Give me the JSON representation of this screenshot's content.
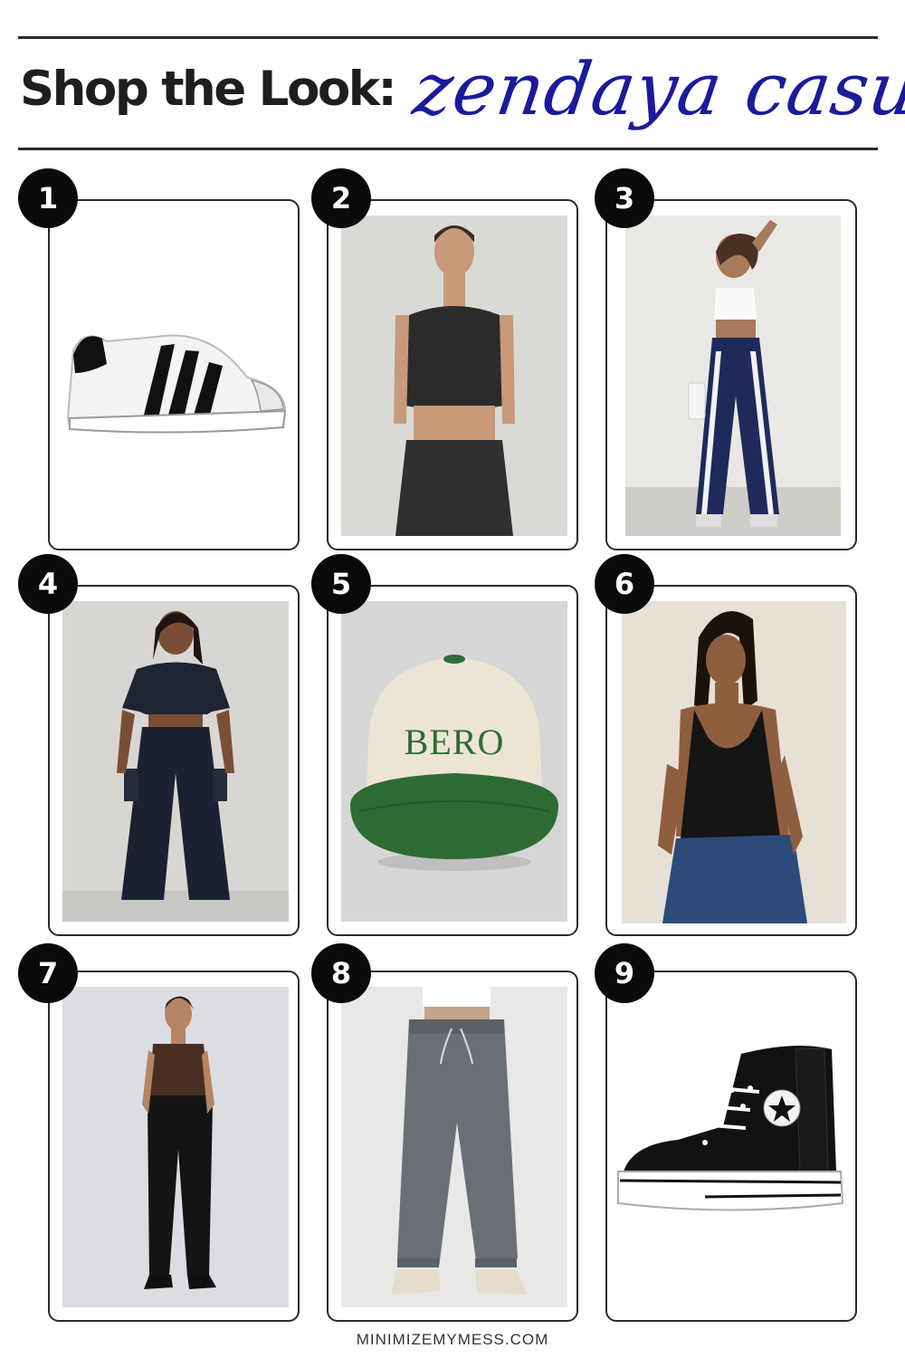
{
  "header": {
    "title": "Shop the Look:",
    "script_title": "zendaya casual"
  },
  "items": [
    {
      "number": "1",
      "icon": "white-sneaker-black-stripes"
    },
    {
      "number": "2",
      "icon": "model-black-halter-top"
    },
    {
      "number": "3",
      "icon": "model-white-tank-navy-track-pants"
    },
    {
      "number": "4",
      "icon": "model-navy-crop-top-cargo-pants"
    },
    {
      "number": "5",
      "icon": "cream-green-baseball-cap",
      "cap_text": "BERO"
    },
    {
      "number": "6",
      "icon": "model-black-tank-jeans"
    },
    {
      "number": "7",
      "icon": "model-brown-tube-top-black-trousers"
    },
    {
      "number": "8",
      "icon": "grey-sweatpants"
    },
    {
      "number": "9",
      "icon": "black-high-top-platform-sneaker"
    }
  ],
  "footer": {
    "site": "MINIMIZEMYMESS.COM"
  },
  "colors": {
    "accent_script": "#1a1a9c",
    "badge": "#0a0a0a",
    "border": "#2a2a2a"
  }
}
